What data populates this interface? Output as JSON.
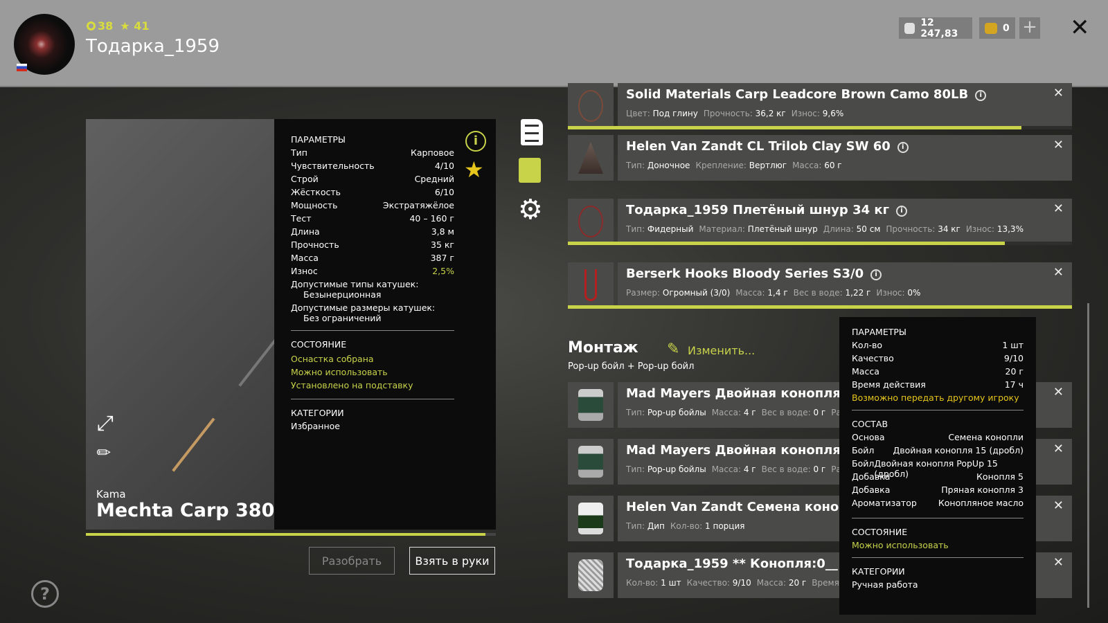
{
  "header": {
    "level": "38",
    "stars": "41",
    "username": "Тодарка_1959",
    "silver": "12 247,83",
    "gold": "0"
  },
  "rod": {
    "brand": "Kama",
    "name": "Mechta Carp 380",
    "wear_fraction": 0.975,
    "params_title": "ПАРАМЕТРЫ",
    "params": [
      {
        "k": "Тип",
        "v": "Карповое"
      },
      {
        "k": "Чувствительность",
        "v": "4/10"
      },
      {
        "k": "Строй",
        "v": "Средний"
      },
      {
        "k": "Жёсткость",
        "v": "6/10"
      },
      {
        "k": "Мощность",
        "v": "Экстратяжёлое"
      },
      {
        "k": "Тест",
        "v": "40 – 160 г"
      },
      {
        "k": "Длина",
        "v": "3,8 м"
      },
      {
        "k": "Прочность",
        "v": "35 кг"
      },
      {
        "k": "Масса",
        "v": "387 г"
      },
      {
        "k": "Износ",
        "v": "2,5%"
      }
    ],
    "reel_types_label": "Допустимые типы катушек:",
    "reel_types": "Безынерционная",
    "reel_sizes_label": "Допустимые размеры катушек:",
    "reel_sizes": "Без ограничений",
    "state_title": "СОСТОЯНИЕ",
    "states": [
      "Оснастка собрана",
      "Можно использовать",
      "Установлено на подставку"
    ],
    "cat_title": "КАТЕГОРИИ",
    "category": "Избранное",
    "disassemble": "Разобрать",
    "take": "Взять в руки"
  },
  "items": [
    {
      "title": "Solid Materials Carp Leadcore Brown Camo 80LB",
      "specs": [
        {
          "k": "Цвет:",
          "v": "Под глину"
        },
        {
          "k": "Прочность:",
          "v": "36,2 кг"
        },
        {
          "k": "Износ:",
          "v": "9,6%",
          "g": true
        }
      ],
      "wear": 0.9
    },
    {
      "title": "Helen Van Zandt CL Trilob Clay SW 60",
      "specs": [
        {
          "k": "Тип:",
          "v": "Доночное"
        },
        {
          "k": "Крепление:",
          "v": "Вертлюг"
        },
        {
          "k": "Масса:",
          "v": "60 г"
        }
      ]
    },
    {
      "title": "Тодарка_1959 Плетёный шнур 34 кг",
      "specs": [
        {
          "k": "Тип:",
          "v": "Фидерный"
        },
        {
          "k": "Материал:",
          "v": "Плетёный шнур"
        },
        {
          "k": "Длина:",
          "v": "50 см"
        },
        {
          "k": "Прочность:",
          "v": "34 кг"
        },
        {
          "k": "Износ:",
          "v": "13,3%",
          "g": true
        }
      ],
      "wear": 0.867
    },
    {
      "title": "Berserk Hooks Bloody Series S3/0",
      "specs": [
        {
          "k": "Размер:",
          "v": "Огромный (3/0)"
        },
        {
          "k": "Масса:",
          "v": "1,4 г"
        },
        {
          "k": "Вес в воде:",
          "v": "1,22 г"
        },
        {
          "k": "Износ:",
          "v": "0%",
          "g": true
        }
      ],
      "wear": 1.0
    }
  ],
  "montage": {
    "title": "Монтаж",
    "change": "Изменить...",
    "rig": "Pop-up бойл  +  Pop-up бойл"
  },
  "baits": [
    {
      "title": "Mad Mayers Двойная конопля PopUp 15 (дробл)",
      "specs": [
        {
          "k": "Тип:",
          "v": "Pop-up бойлы"
        },
        {
          "k": "Масса:",
          "v": "4 г"
        },
        {
          "k": "Вес в воде:",
          "v": "0 г"
        },
        {
          "k": "Размер:",
          "v": ""
        }
      ]
    },
    {
      "title": "Mad Mayers Двойная конопля PopUp 15 (дробл)",
      "specs": [
        {
          "k": "Тип:",
          "v": "Pop-up бойлы"
        },
        {
          "k": "Масса:",
          "v": "4 г"
        },
        {
          "k": "Вес в воде:",
          "v": "0 г"
        },
        {
          "k": "Размер:",
          "v": ""
        }
      ]
    },
    {
      "title": "Helen Van Zandt Семена конопли",
      "specs": [
        {
          "k": "Тип:",
          "v": "Дип"
        },
        {
          "k": "Кол-во:",
          "v": "1 порция"
        }
      ]
    },
    {
      "title": "Тодарка_1959 ** Конопля:0__ **",
      "specs": [
        {
          "k": "Кол-во:",
          "v": "1 шт"
        },
        {
          "k": "Качество:",
          "v": "9/10"
        },
        {
          "k": "Масса:",
          "v": "20 г"
        },
        {
          "k": "Время действия:",
          "v": ""
        }
      ]
    }
  ],
  "tooltip": {
    "params_title": "ПАРАМЕТРЫ",
    "params": [
      {
        "k": "Кол-во",
        "v": "1 шт"
      },
      {
        "k": "Качество",
        "v": "9/10"
      },
      {
        "k": "Масса",
        "v": "20 г"
      },
      {
        "k": "Время действия",
        "v": "17 ч"
      }
    ],
    "transfer": "Возможно передать другому игроку",
    "comp_title": "СОСТАВ",
    "comp": [
      {
        "k": "Основа",
        "v": "Семена конопли"
      },
      {
        "k": "Бойл",
        "v": "Двойная конопля 15 (дробл)"
      },
      {
        "k": "Бойл",
        "v": "Двойная конопля PopUp 15 (дробл)"
      },
      {
        "k": "Добавка",
        "v": "Конопля 5"
      },
      {
        "k": "Добавка",
        "v": "Пряная конопля 3"
      },
      {
        "k": "Ароматизатор",
        "v": "Конопляное масло"
      }
    ],
    "state_title": "СОСТОЯНИЕ",
    "state": "Можно использовать",
    "cat_title": "КАТЕГОРИИ",
    "category": "Ручная работа"
  }
}
